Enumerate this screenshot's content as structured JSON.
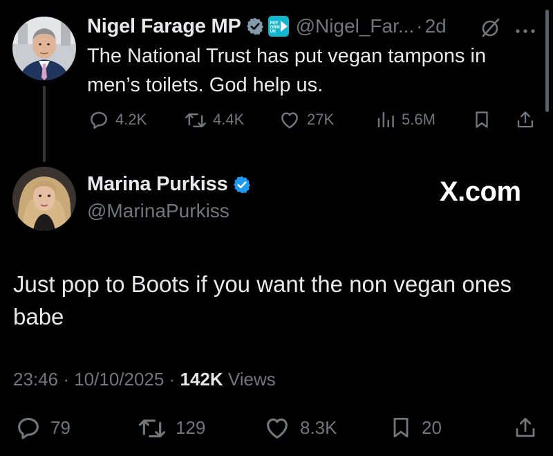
{
  "parent_tweet": {
    "author_name": "Nigel Farage MP",
    "handle": "@Nigel_Far...",
    "separator": "·",
    "time_ago": "2d",
    "badge_text": "REFORM UK",
    "text": "The National Trust has put vegan tampons in men’s toilets. God help us.",
    "replies": "4.2K",
    "reposts": "4.4K",
    "likes": "27K",
    "views": "5.6M"
  },
  "reply_tweet": {
    "author_name": "Marina Purkiss",
    "handle": "@MarinaPurkiss",
    "watermark": "X.com",
    "text": "Just pop to Boots if you want the non vegan ones babe",
    "time": "23:46",
    "separator": "·",
    "date": "10/10/2025",
    "views_count": "142K",
    "views_label": "Views",
    "replies": "79",
    "reposts": "129",
    "likes": "8.3K",
    "bookmarks": "20"
  },
  "colors": {
    "background": "#000000",
    "text_primary": "#e7e9ea",
    "text_secondary": "#71767b",
    "verified_blue": "#1d9bf0",
    "verified_gray": "#829aab",
    "party_badge": "#12b6cf"
  },
  "icons": {
    "reply": "reply-icon",
    "repost": "repost-icon",
    "like": "heart-icon",
    "views": "views-icon",
    "bookmark": "bookmark-icon",
    "share": "share-icon",
    "more": "more-icon",
    "grok": "grok-icon"
  }
}
